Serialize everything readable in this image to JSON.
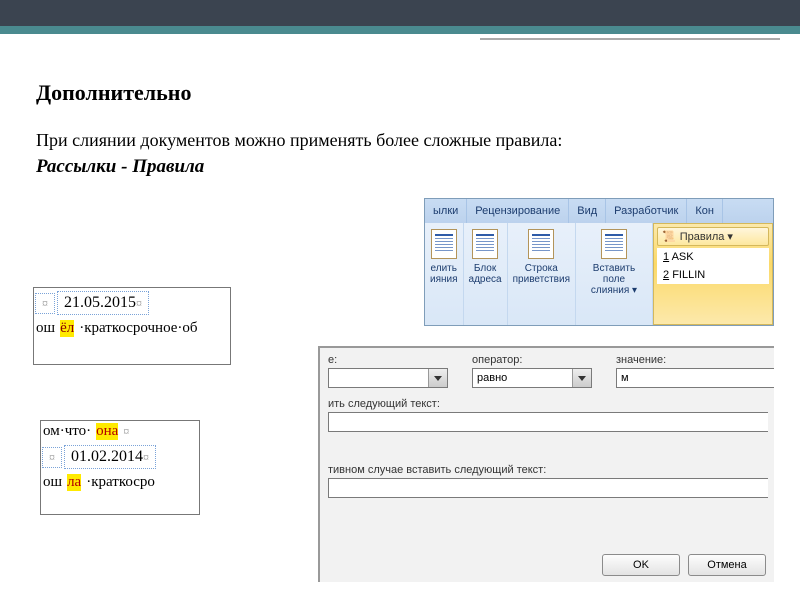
{
  "header": {
    "title": "Дополнительно",
    "body": "При слиянии документов можно применять более сложные правила:",
    "subtitle": "Рассылки - Правила"
  },
  "ribbon": {
    "tabs": [
      "ылки",
      "Рецензирование",
      "Вид",
      "Разработчик",
      "Кон"
    ],
    "buttons": {
      "b1_line1": "елить",
      "b1_line2": "ияния",
      "b2_line1": "Блок",
      "b2_line2": "адреса",
      "b3_line1": "Строка",
      "b3_line2": "приветствия",
      "b4_line1": "Вставить поле",
      "b4_line2": "слияния ▾"
    },
    "rules_header": "Правила ▾",
    "rules_items": [
      {
        "num": "1",
        "label": "ASK"
      },
      {
        "num": "2",
        "label": "FILLIN"
      }
    ]
  },
  "doc1": {
    "date": "21.05.2015",
    "line2_pre": "ош",
    "line2_hl": "ёл",
    "line2_post": "·краткосрочное·об"
  },
  "doc2": {
    "line1_pre": "ом·что·",
    "line1_hl": "она",
    "date": "01.02.2014",
    "line3_pre": "ош",
    "line3_hl": "ла",
    "line3_post": "·краткосро"
  },
  "dialog": {
    "labels": {
      "col1": "е:",
      "operator": "оператор:",
      "value": "значение:",
      "insert_text": "ить следующий текст:",
      "else_text": "тивном случае вставить следующий текст:"
    },
    "operator_value": "равно",
    "value_value": "м",
    "buttons": {
      "ok": "OK",
      "cancel": "Отмена"
    }
  }
}
